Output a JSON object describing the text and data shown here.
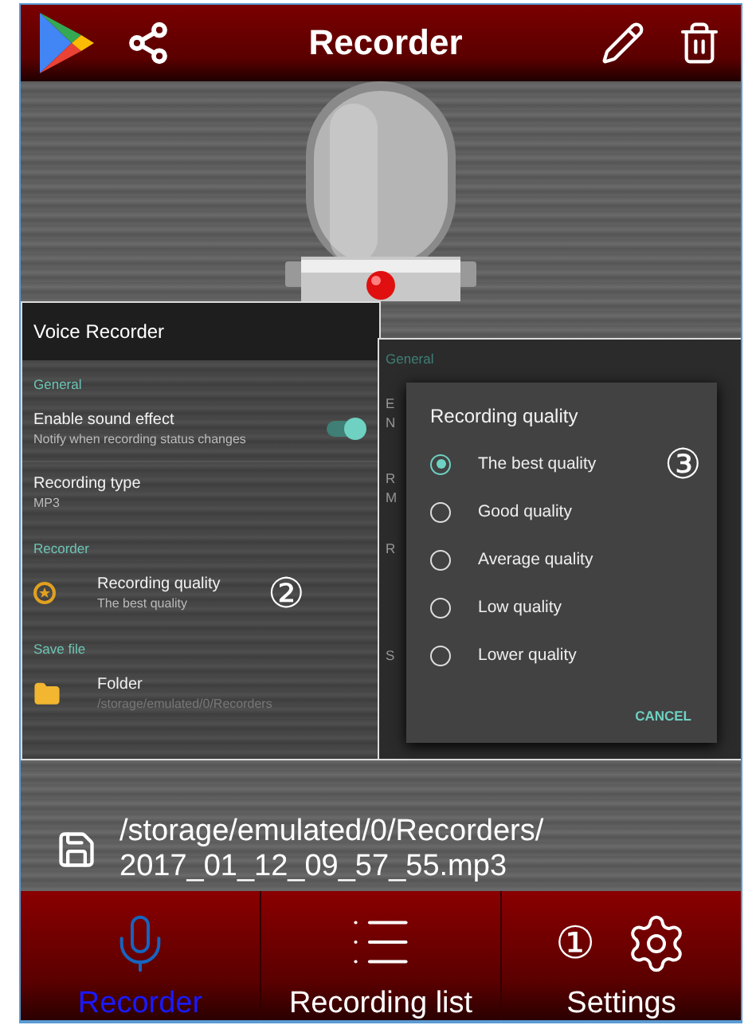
{
  "header": {
    "title": "Recorder"
  },
  "settings_screen": {
    "title": "Voice Recorder",
    "sections": [
      {
        "heading": "General",
        "items": [
          {
            "kind": "toggle",
            "title": "Enable sound effect",
            "subtitle": "Notify when recording status changes",
            "on": true
          },
          {
            "kind": "plain",
            "title": "Recording type",
            "subtitle": "MP3"
          }
        ]
      },
      {
        "heading": "Recorder",
        "items": [
          {
            "kind": "quality",
            "title": "Recording quality",
            "subtitle": "The best quality",
            "callout": "②"
          }
        ]
      },
      {
        "heading": "Save file",
        "items": [
          {
            "kind": "folder",
            "title": "Folder",
            "subtitle": "/storage/emulated/0/Recorders"
          }
        ]
      }
    ]
  },
  "dialog_screen": {
    "background": {
      "heading": "General",
      "fragments": [
        "E",
        "N",
        "R",
        "M",
        "R",
        "S"
      ]
    },
    "dialog": {
      "title": "Recording quality",
      "callout": "③",
      "cancel": "CANCEL",
      "options": [
        {
          "label": "The best quality",
          "selected": true
        },
        {
          "label": "Good quality",
          "selected": false
        },
        {
          "label": "Average quality",
          "selected": false
        },
        {
          "label": "Low quality",
          "selected": false
        },
        {
          "label": "Lower quality",
          "selected": false
        }
      ]
    }
  },
  "file_path": {
    "lines": [
      "/storage/emulated/0/Recorders/",
      "2017_01_12_09_57_55.mp3"
    ]
  },
  "nav": [
    {
      "label": "Recorder",
      "kind": "mic",
      "selected": true
    },
    {
      "label": "Recording list",
      "kind": "list",
      "selected": false
    },
    {
      "label": "Settings",
      "kind": "gear",
      "selected": false,
      "callout": "①"
    }
  ]
}
